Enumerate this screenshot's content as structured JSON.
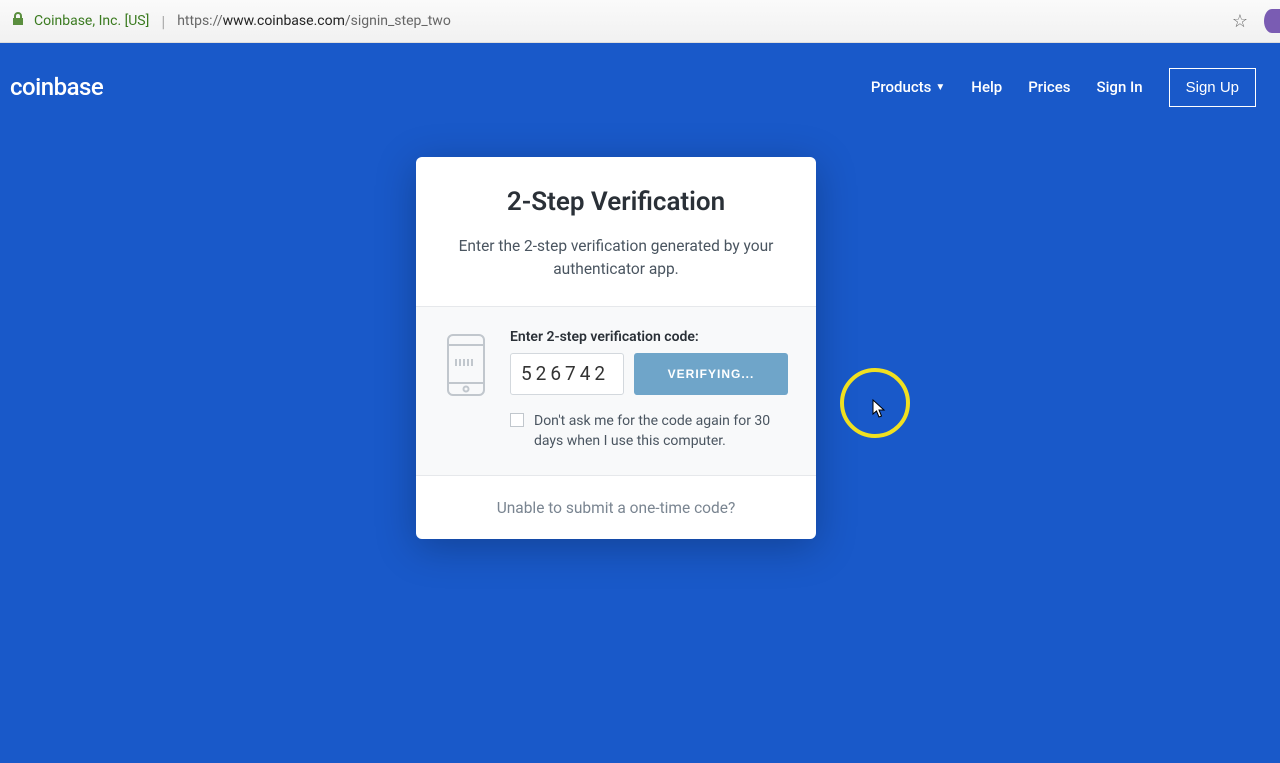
{
  "browser": {
    "site_identity": "Coinbase, Inc. [US]",
    "url_prefix": "https://",
    "url_host": "www.coinbase.com",
    "url_path": "/signin_step_two"
  },
  "nav": {
    "logo": "coinbase",
    "products": "Products",
    "help": "Help",
    "prices": "Prices",
    "signin": "Sign In",
    "signup": "Sign Up"
  },
  "card": {
    "title": "2-Step Verification",
    "subtitle": "Enter the 2-step verification generated by your authenticator app.",
    "field_label": "Enter 2-step verification code:",
    "code_value": "526742",
    "button_label": "VERIFYING...",
    "checkbox_label": "Don't ask me for the code again for 30 days when I use this computer.",
    "footer_link": "Unable to submit a one-time code?"
  }
}
